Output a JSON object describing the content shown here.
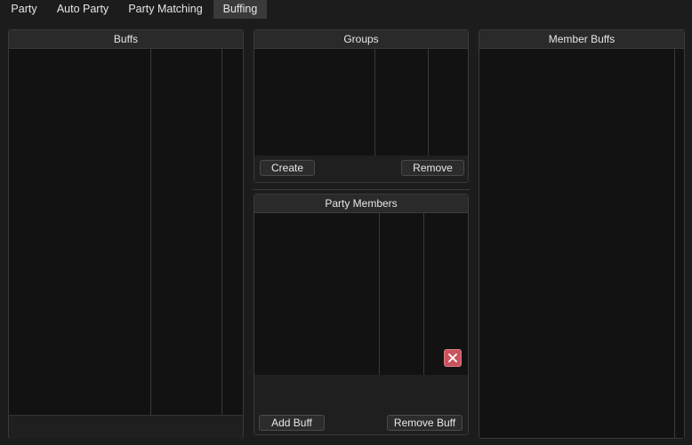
{
  "tabs": [
    {
      "label": "Party",
      "active": false
    },
    {
      "label": "Auto Party",
      "active": false
    },
    {
      "label": "Party Matching",
      "active": false
    },
    {
      "label": "Buffing",
      "active": true
    }
  ],
  "buffs_panel": {
    "title": "Buffs"
  },
  "groups_panel": {
    "title": "Groups",
    "create_label": "Create",
    "remove_label": "Remove"
  },
  "party_members_panel": {
    "title": "Party Members",
    "add_buff_label": "Add Buff",
    "remove_buff_label": "Remove Buff",
    "close_icon": "close-icon"
  },
  "member_buffs_panel": {
    "title": "Member Buffs"
  },
  "colors": {
    "background": "#1c1c1c",
    "panel": "#141414",
    "header": "#2a2a2a",
    "active_tab": "#3a3a3a",
    "close_button": "#c9545e"
  }
}
